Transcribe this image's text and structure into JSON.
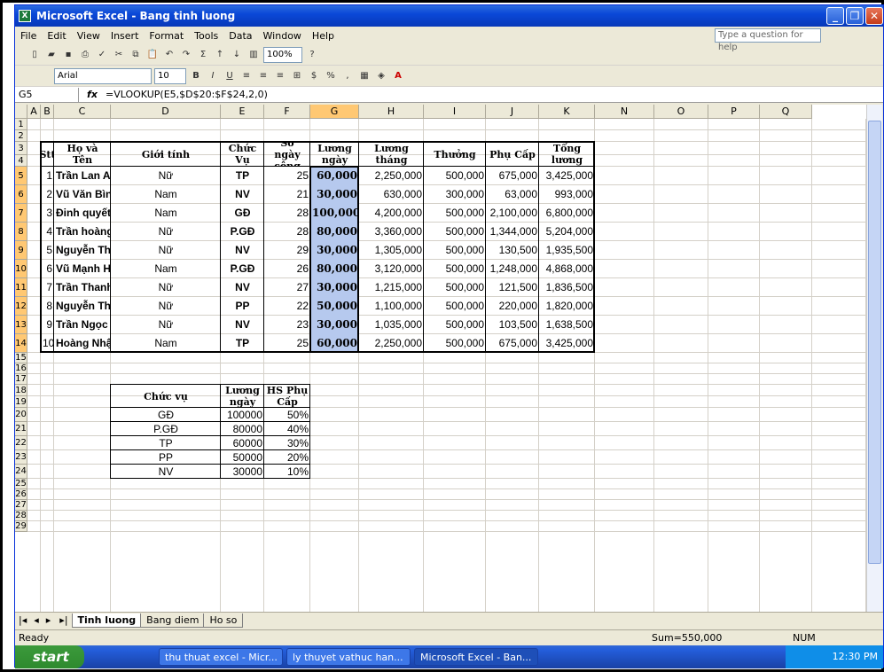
{
  "window": {
    "title": "Microsoft Excel - Bang tinh luong"
  },
  "menu": [
    "File",
    "Edit",
    "View",
    "Insert",
    "Format",
    "Tools",
    "Data",
    "Window",
    "Help"
  ],
  "help_placeholder": "Type a question for help",
  "toolbar": {
    "zoom": "100%",
    "font": "Arial",
    "size": "10"
  },
  "formula_bar": {
    "name_box": "G5",
    "fx": "fx",
    "formula": "=VLOOKUP(E5,$D$20:$F$24,2,0)"
  },
  "columns": [
    "A",
    "B",
    "C",
    "D",
    "E",
    "F",
    "G",
    "H",
    "I",
    "J",
    "K",
    "N",
    "O",
    "P",
    "Q"
  ],
  "rows": [
    "1",
    "2",
    "3",
    "4",
    "5",
    "6",
    "7",
    "8",
    "9",
    "10",
    "11",
    "12",
    "13",
    "14",
    "15",
    "16",
    "17",
    "18",
    "19",
    "20",
    "21",
    "22",
    "23",
    "24",
    "25",
    "26",
    "27",
    "28",
    "29"
  ],
  "salary_table": {
    "headers": [
      "Stt",
      "Họ và Tên",
      "Giới tính",
      "Chức Vụ",
      "Số ngày công",
      "Lương ngày",
      "Lương tháng",
      "Thưởng",
      "Phụ Cấp",
      "Tổng lương"
    ],
    "rows": [
      [
        "1",
        "Trần Lan Anh",
        "Nữ",
        "TP",
        "25",
        "60,000",
        "2,250,000",
        "500,000",
        "675,000",
        "3,425,000"
      ],
      [
        "2",
        "Vũ Văn Bình",
        "Nam",
        "NV",
        "21",
        "30,000",
        "630,000",
        "300,000",
        "63,000",
        "993,000"
      ],
      [
        "3",
        "Đinh quyết Chiến",
        "Nam",
        "GĐ",
        "28",
        "100,000",
        "4,200,000",
        "500,000",
        "2,100,000",
        "6,800,000"
      ],
      [
        "4",
        "Trần hoàng Dung",
        "Nữ",
        "P.GĐ",
        "28",
        "80,000",
        "3,360,000",
        "500,000",
        "1,344,000",
        "5,204,000"
      ],
      [
        "5",
        "Nguyễn Thị Giang",
        "Nữ",
        "NV",
        "29",
        "30,000",
        "1,305,000",
        "500,000",
        "130,500",
        "1,935,500"
      ],
      [
        "6",
        "Vũ Mạnh Hùng",
        "Nam",
        "P.GĐ",
        "26",
        "80,000",
        "3,120,000",
        "500,000",
        "1,248,000",
        "4,868,000"
      ],
      [
        "7",
        "Trần Thanh Hương",
        "Nữ",
        "NV",
        "27",
        "30,000",
        "1,215,000",
        "500,000",
        "121,500",
        "1,836,500"
      ],
      [
        "8",
        "Nguyễn Thị Huệ",
        "Nữ",
        "PP",
        "22",
        "50,000",
        "1,100,000",
        "500,000",
        "220,000",
        "1,820,000"
      ],
      [
        "9",
        "Trần Ngọc Nga",
        "Nữ",
        "NV",
        "23",
        "30,000",
        "1,035,000",
        "500,000",
        "103,500",
        "1,638,500"
      ],
      [
        "10",
        "Hoàng Nhật Minh",
        "Nam",
        "TP",
        "25",
        "60,000",
        "2,250,000",
        "500,000",
        "675,000",
        "3,425,000"
      ]
    ]
  },
  "lookup_table": {
    "headers": [
      "Chức vụ",
      "Lương ngày",
      "HS Phụ Cấp"
    ],
    "rows": [
      [
        "GĐ",
        "100000",
        "50%"
      ],
      [
        "P.GĐ",
        "80000",
        "40%"
      ],
      [
        "TP",
        "60000",
        "30%"
      ],
      [
        "PP",
        "50000",
        "20%"
      ],
      [
        "NV",
        "30000",
        "10%"
      ]
    ]
  },
  "sheet_tabs": [
    "Tinh luong",
    "Bang diem",
    "Ho so"
  ],
  "status": {
    "ready": "Ready",
    "sum": "Sum=550,000",
    "num": "NUM"
  },
  "taskbar": {
    "start": "start",
    "tasks": [
      "thu thuat excel - Micr...",
      "ly thuyet vathuc han...",
      "Microsoft Excel - Ban..."
    ],
    "clock": "12:30 PM"
  }
}
